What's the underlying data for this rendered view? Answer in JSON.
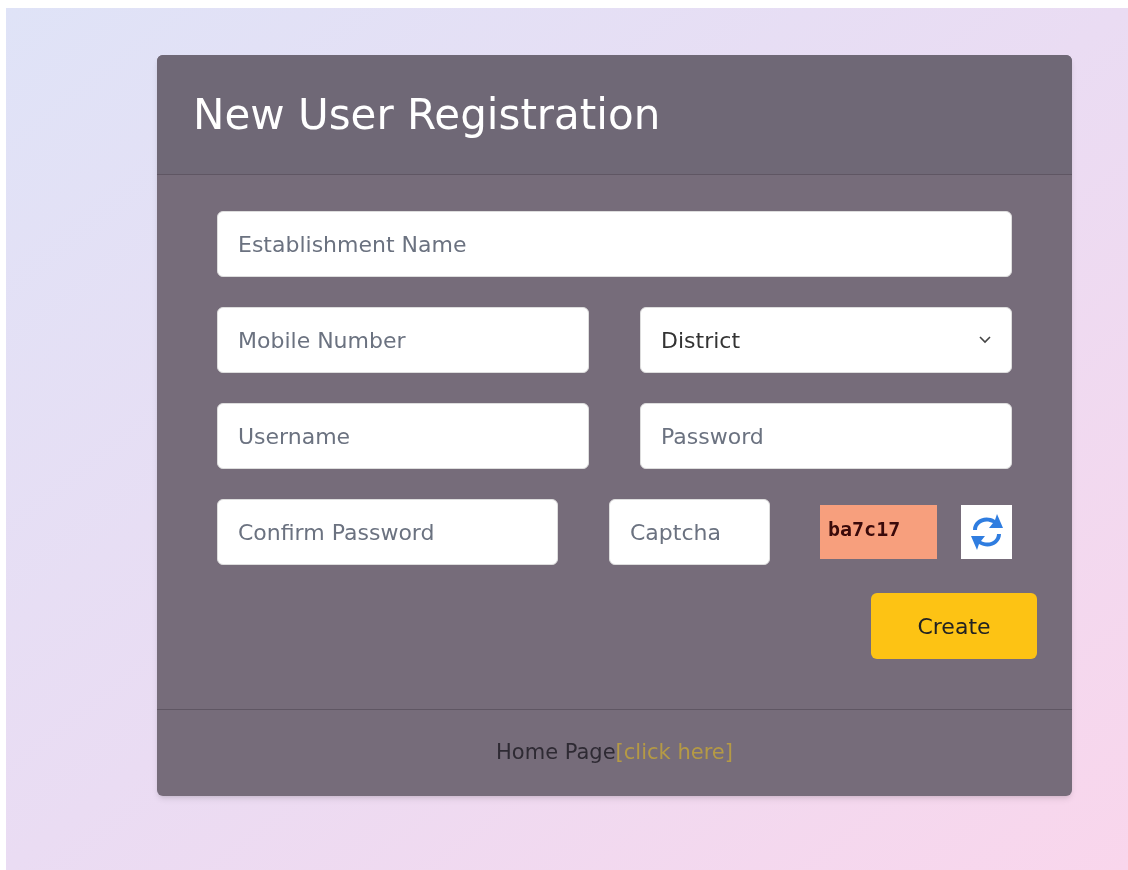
{
  "title": "New User Registration",
  "rows": [
    [
      {
        "kind": "text",
        "placeholder": "Establishment Name"
      }
    ],
    [
      {
        "kind": "text",
        "placeholder": "Mobile Number"
      },
      {
        "kind": "select",
        "value": "District"
      }
    ],
    [
      {
        "kind": "text",
        "placeholder": "Username"
      },
      {
        "kind": "text",
        "placeholder": "Password"
      }
    ],
    [
      {
        "kind": "text",
        "placeholder": "Confirm Password"
      },
      {
        "kind": "captcha",
        "placeholder": "Captcha",
        "code": "ba7c17"
      }
    ]
  ],
  "button": "Create",
  "footer": {
    "text": "Home Page",
    "link": "[click here]"
  }
}
